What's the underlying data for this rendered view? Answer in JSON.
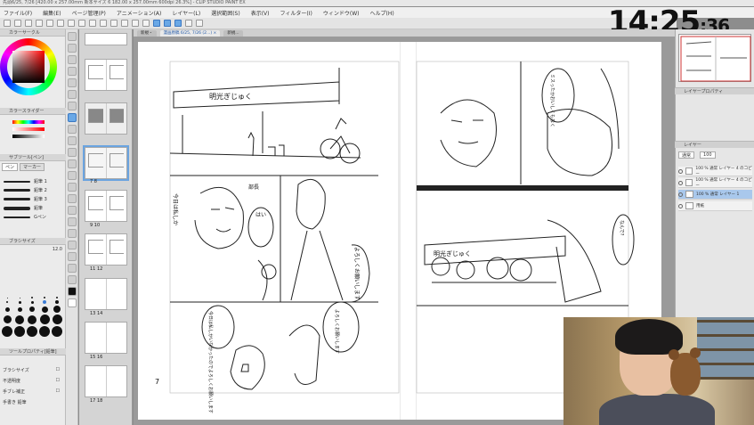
{
  "window": {
    "title": "先頭6/25, 7/26 [420.00 x 257.00mm 新本サイズ 6 182.00 x 257.00mm 600dpi 26.3%] - CLIP STUDIO PAINT EX"
  },
  "clock": {
    "hm": "14:25",
    "sec": ":36"
  },
  "menu": [
    "ファイル(F)",
    "編集(E)",
    "ページ管理(P)",
    "アニメーション(A)",
    "レイヤー(L)",
    "選択範囲(S)",
    "表示(V)",
    "フィルター(I)",
    "ウィンドウ(W)",
    "ヘルプ(H)"
  ],
  "tabs": [
    {
      "label": "新規・"
    },
    {
      "label": "漫画原稿 6/25, 7/26 (2...) ×"
    },
    {
      "label": "新規..."
    }
  ],
  "left_panels": {
    "color_wheel_title": "カラーサークル",
    "color_slider_title": "カラースライダー",
    "sub_tool_title": "サブツール[ペン]",
    "sub_tool_tabs": [
      "ペン",
      "マーカー"
    ],
    "brushes": [
      "鉛筆 1",
      "鉛筆 2",
      "鉛筆 3",
      "鉛筆",
      "Gペン"
    ],
    "brush_size_title": "ブラシサイズ",
    "brush_size_value": "12.0",
    "brush_sizes": [
      "1",
      "2",
      "3",
      "4",
      "5",
      "6",
      "8",
      "10",
      "12",
      "15",
      "20",
      "25",
      "30",
      "40",
      "50",
      "60",
      "70",
      "80",
      "100",
      "120",
      "150",
      "200",
      "250",
      "300",
      "400",
      "500"
    ],
    "tool_property_title": "ツールプロパティ[鉛筆]",
    "props": [
      "ブラシサイズ",
      "不透明度",
      "手ブレ補正",
      "手書き 鉛筆"
    ]
  },
  "page_manager": {
    "spreads": [
      {
        "label": "",
        "selected": false
      },
      {
        "label": "",
        "selected": false
      },
      {
        "label": "",
        "selected": false
      },
      {
        "label": "7    8",
        "selected": true
      },
      {
        "label": "9    10",
        "selected": false
      },
      {
        "label": "11    12",
        "selected": false
      },
      {
        "label": "13    14",
        "selected": false
      },
      {
        "label": "15    16",
        "selected": false
      },
      {
        "label": "17    18",
        "selected": false
      }
    ]
  },
  "canvas": {
    "page_number": "7",
    "left_page": {
      "sign_text": "明光ぎじゅく",
      "bubble1": "部長",
      "bubble2": "今日は私しかいなかったのでよろしくお願いします",
      "bubble3": "よろしくお願いします",
      "bubble4": "はい",
      "bubble5": "よろしくお願いします",
      "bubble6": "今日は私しか"
    },
    "right_page": {
      "bubble1": "ミスったかおいしくもなく",
      "sign_text": "明光ぎじゅく",
      "bubble2": "なんで?"
    }
  },
  "right_panels": {
    "navigator_title": "ナビゲーター",
    "layer_property_title": "レイヤープロパティ",
    "layer_title": "レイヤー",
    "blend_mode": "通常",
    "opacity": "100",
    "layers": [
      {
        "name": "100 % 通常 レイヤー 4 のコピー",
        "selected": false
      },
      {
        "name": "100 % 通常 レイヤー 4 のコピー",
        "selected": false
      },
      {
        "name": "100 % 通常 レイヤー 1",
        "selected": true
      },
      {
        "name": "用紙",
        "selected": false
      }
    ]
  }
}
